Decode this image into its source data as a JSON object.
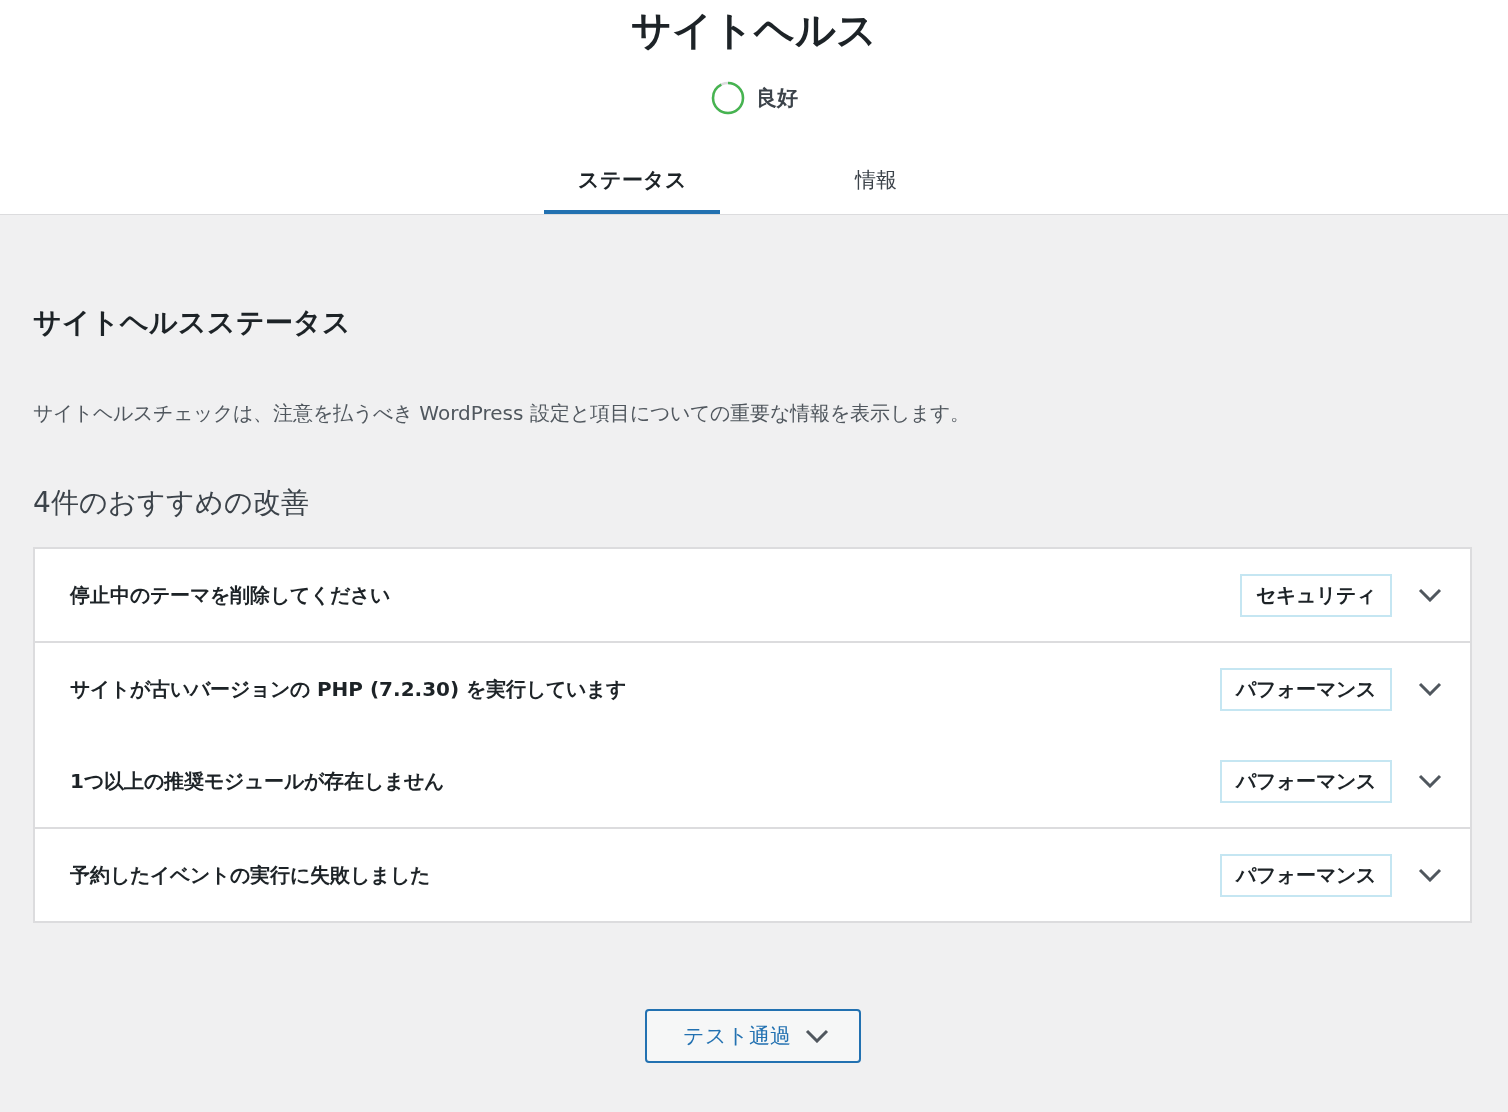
{
  "header": {
    "title": "サイトヘルス",
    "status": {
      "label": "良好"
    }
  },
  "tabs": [
    {
      "label": "ステータス",
      "selected": true
    },
    {
      "label": "情報",
      "selected": false
    }
  ],
  "section": {
    "title": "サイトヘルスステータス",
    "description": "サイトヘルスチェックは、注意を払うべき WordPress 設定と項目についての重要な情報を表示します。",
    "count_heading": "4件のおすすめの改善"
  },
  "issue_groups": [
    {
      "items": [
        {
          "title": "停止中のテーマを削除してください",
          "badge": "セキュリティ",
          "expanded": false
        }
      ]
    },
    {
      "items": [
        {
          "title": "サイトが古いバージョンの PHP (7.2.30) を実行しています",
          "badge": "パフォーマンス",
          "expanded": false
        },
        {
          "title": "1つ以上の推奨モジュールが存在しません",
          "badge": "パフォーマンス",
          "expanded": false
        }
      ]
    },
    {
      "items": [
        {
          "title": "予約したイベントの実行に失敗しました",
          "badge": "パフォーマンス",
          "expanded": false
        }
      ]
    }
  ],
  "passed_button": {
    "label": "テスト通過",
    "expanded": false
  }
}
